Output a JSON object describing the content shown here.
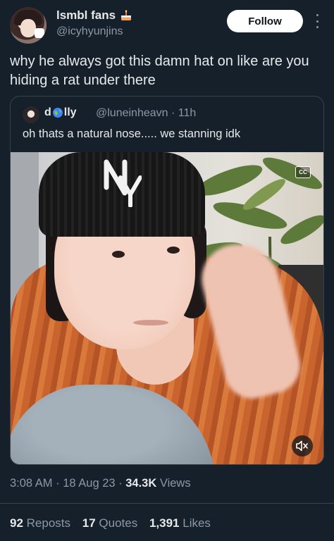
{
  "author": {
    "display_name": "lsmbl fans",
    "handle": "@icyhyunjins",
    "name_emoji_icon": "birthday-cake-icon"
  },
  "follow_button": {
    "label": "Follow"
  },
  "tweet": {
    "text": "why he always got this damn hat on like are you hiding a rat under there"
  },
  "quote": {
    "name_prefix": "d",
    "name_suffix": "lly",
    "name_emoji_icon": "globe-icon",
    "handle": "@luneinheavn",
    "time": "· 11h",
    "text": "oh thats a natural nose..... we stanning idk",
    "video": {
      "cc_label": "CC",
      "mute_icon": "muted-speaker-icon"
    }
  },
  "meta": {
    "time": "3:08 AM",
    "date": "18 Aug 23",
    "views_count": "34.3K",
    "views_label": "Views"
  },
  "stats": {
    "reposts_count": "92",
    "reposts_label": "Reposts",
    "quotes_count": "17",
    "quotes_label": "Quotes",
    "likes_count": "1,391",
    "likes_label": "Likes"
  },
  "colors": {
    "background": "#15202b",
    "primary_text": "#e7e9ea",
    "secondary_text": "#8b98a5",
    "border": "#38444d"
  }
}
